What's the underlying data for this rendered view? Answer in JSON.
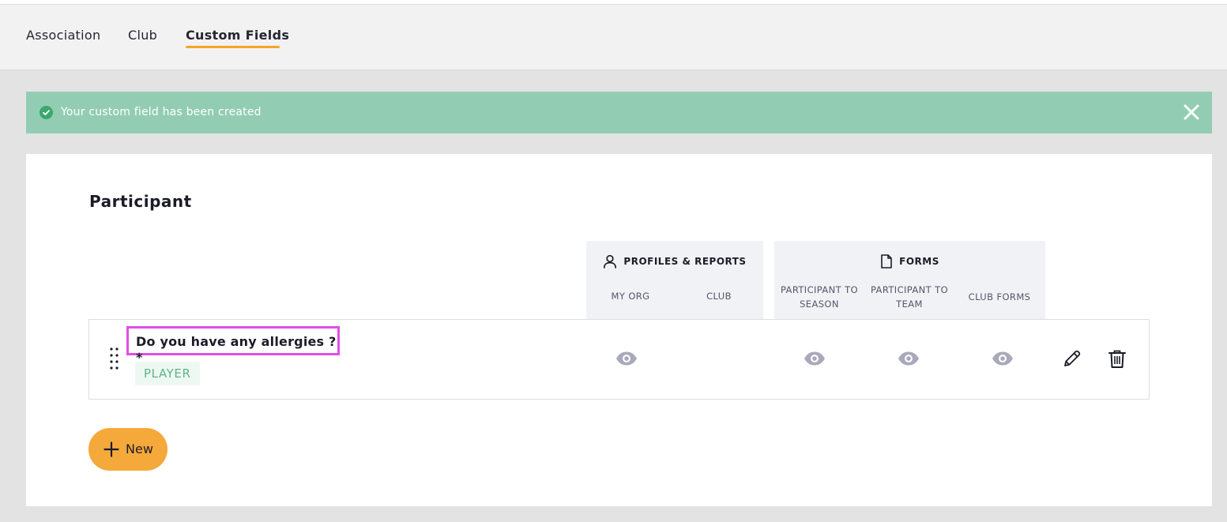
{
  "tabs": [
    {
      "label": "Association",
      "active": false
    },
    {
      "label": "Club",
      "active": false
    },
    {
      "label": "Custom Fields",
      "active": true
    }
  ],
  "alert": {
    "message": "Your custom field has been created",
    "icon": "check-circle-icon",
    "close_icon": "close-icon"
  },
  "section": {
    "title": "Participant"
  },
  "groups": {
    "profiles": {
      "icon": "user-icon",
      "label": "PROFILES & REPORTS",
      "columns": [
        "MY ORG",
        "CLUB"
      ]
    },
    "forms": {
      "icon": "document-icon",
      "label": "FORMS",
      "columns": [
        [
          "PARTICIPANT TO",
          "SEASON"
        ],
        [
          "PARTICIPANT TO",
          "TEAM"
        ],
        "CLUB FORMS"
      ]
    }
  },
  "field": {
    "name": "Do you have any allergies ?*",
    "badge": "PLAYER",
    "visibility": {
      "my_org": true,
      "club": false,
      "participant_to_season": true,
      "participant_to_team": true,
      "club_forms": true
    }
  },
  "actions": {
    "edit_icon": "pencil-icon",
    "delete_icon": "trash-icon"
  },
  "new_button": {
    "label": "New",
    "icon": "plus-icon"
  },
  "colors": {
    "accent": "#f5a623",
    "alert_bg": "#92cdb3",
    "highlight": "#e04fe6",
    "badge_text": "#5fb587",
    "eye_icon": "#a9a9bb"
  }
}
